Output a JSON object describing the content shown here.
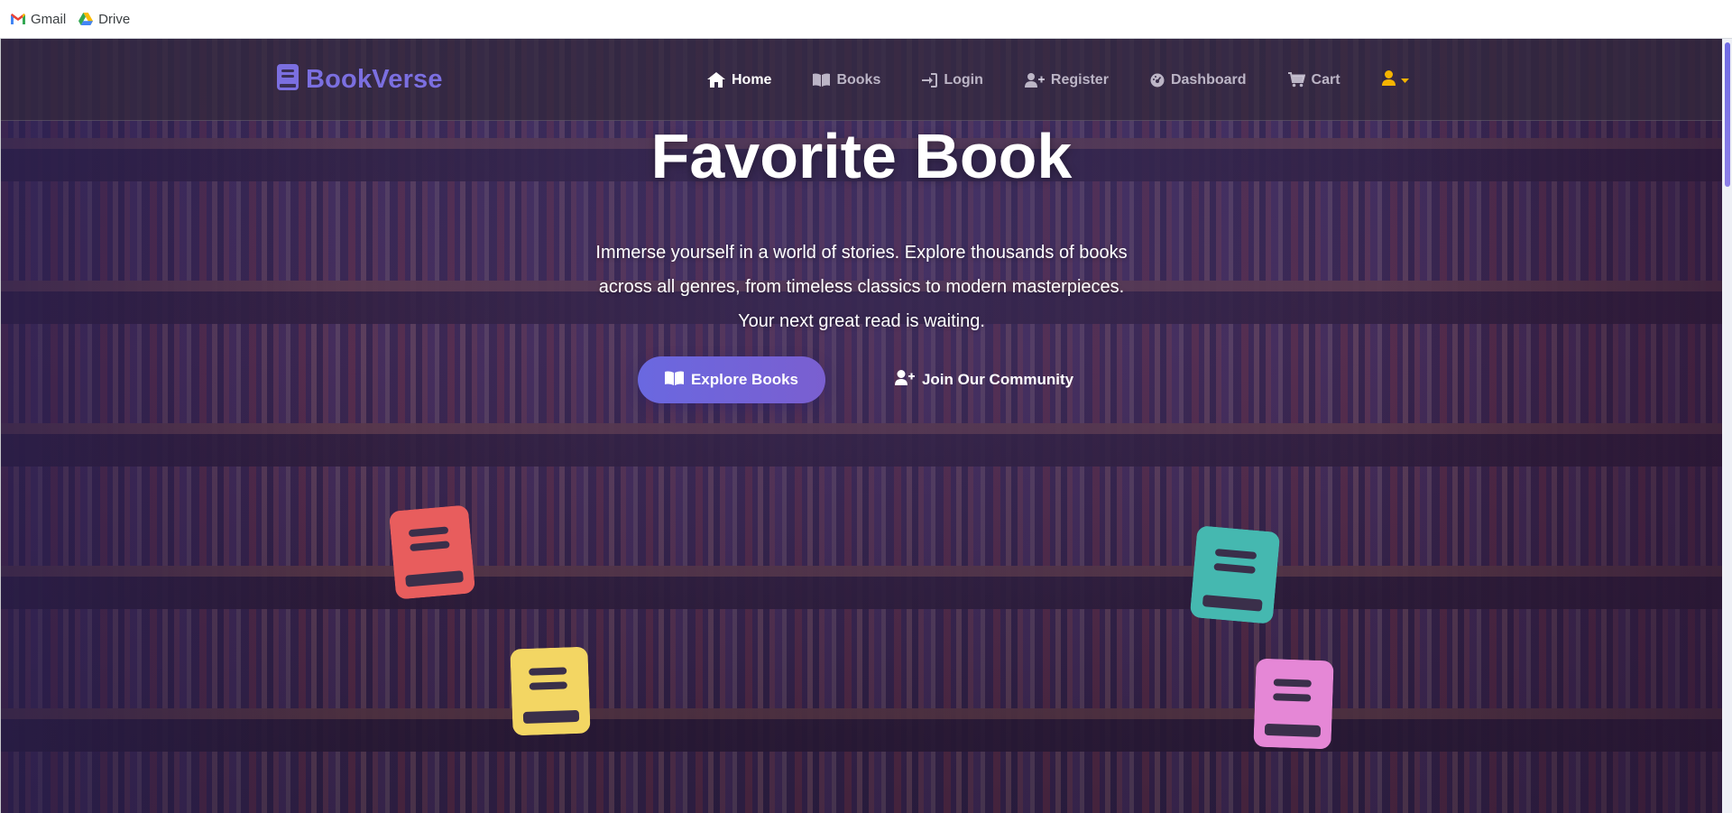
{
  "browser": {
    "bookmarks": [
      {
        "label": "Gmail",
        "icon": "gmail-icon"
      },
      {
        "label": "Drive",
        "icon": "drive-icon"
      }
    ]
  },
  "navbar": {
    "brand": "BookVerse",
    "brand_icon": "book-icon",
    "items": [
      {
        "label": "Home",
        "icon": "home-icon",
        "active": true
      },
      {
        "label": "Books",
        "icon": "open-book-icon",
        "active": false
      },
      {
        "label": "Login",
        "icon": "login-icon",
        "active": false
      },
      {
        "label": "Register",
        "icon": "user-plus-icon",
        "active": false
      },
      {
        "label": "Dashboard",
        "icon": "dashboard-icon",
        "active": false
      },
      {
        "label": "Cart",
        "icon": "cart-icon",
        "active": false
      }
    ],
    "user_menu_icon": "user-icon"
  },
  "hero": {
    "title": "Favorite Book",
    "subtitle": "Immerse yourself in a world of stories. Explore thousands of books across all genres, from timeless classics to modern masterpieces. Your next great read is waiting.",
    "primary_button": "Explore Books",
    "secondary_button": "Join Our Community"
  },
  "colors": {
    "brand": "#7b6fe0",
    "accent_button": "#6a68e0",
    "user_icon": "#f5b400",
    "book_red": "#e85d5d",
    "book_yellow": "#f3d663",
    "book_teal": "#45b8b0",
    "book_pink": "#e587d6"
  }
}
